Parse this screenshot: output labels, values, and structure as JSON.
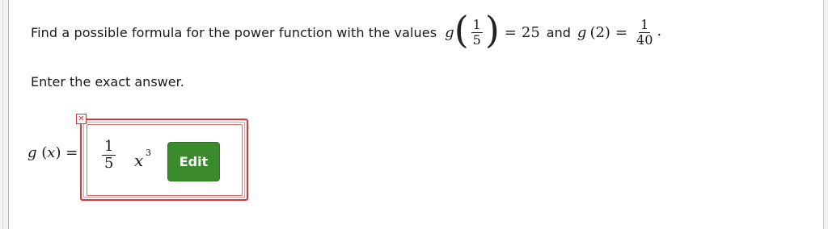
{
  "question": {
    "prefix": "Find a possible formula for the power function with the values",
    "fn_name": "g",
    "arg1_num": "1",
    "arg1_den": "5",
    "equals": "=",
    "value1": "25",
    "conjunction": "and",
    "fn_name2": "g",
    "arg2": "(2)",
    "equals2": "=",
    "value2_num": "1",
    "value2_den": "40",
    "end_punct": "."
  },
  "instruction": "Enter the exact answer.",
  "answer": {
    "label_fn": "g",
    "label_arg_open": "(",
    "label_var": "x",
    "label_arg_close": ")",
    "label_equals": "=",
    "coef_num": "1",
    "coef_den": "5",
    "variable": "x",
    "exponent": "3",
    "status_icon": "incorrect-x-icon",
    "status_mark": "✕"
  },
  "edit_button": {
    "label": "Edit",
    "color": "#3b8a2c"
  },
  "colors": {
    "error": "#d03a3a",
    "text": "#1a1a1a"
  }
}
